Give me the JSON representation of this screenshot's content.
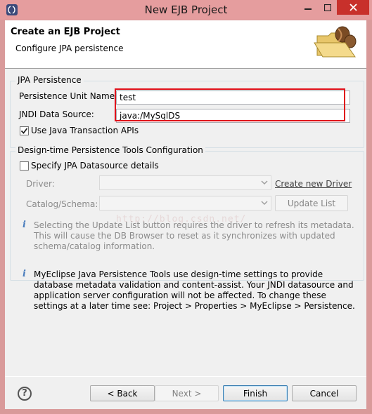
{
  "window": {
    "title": "New EJB Project",
    "icon": "eclipse-app-icon"
  },
  "banner": {
    "title": "Create an EJB Project",
    "subtitle": "Configure JPA persistence",
    "icon": "open-folder-with-beans-icon"
  },
  "jpa": {
    "group_label": "JPA Persistence",
    "unit_name_label": "Persistence Unit Name:",
    "unit_name_value": "test",
    "jndi_label": "JNDI Data Source:",
    "jndi_value": "java:/MySqlDS",
    "use_jta_label": "Use Java Transaction APIs",
    "use_jta_checked": true
  },
  "tools": {
    "group_label": "Design-time Persistence Tools Configuration",
    "specify_label": "Specify JPA Datasource details",
    "specify_checked": false,
    "driver_label": "Driver:",
    "driver_value": "",
    "create_driver_link": "Create new Driver",
    "catalog_label": "Catalog/Schema:",
    "catalog_value": "",
    "update_list_button": "Update List",
    "info_line_1": "Selecting the Update List button requires the driver to refresh its metadata.",
    "info_line_2": "This will cause the DB Browser to reset as it synchronizes with updated",
    "info_line_3": "schema/catalog information."
  },
  "note": {
    "line_1": "MyEclipse Java Persistence Tools use design-time settings to provide",
    "line_2": "database metadata validation and content-assist. Your JNDI datasource and",
    "line_3": "application server configuration will not be affected. To change these",
    "line_4": "settings at a later time see: Project > Properties > MyEclipse > Persistence."
  },
  "watermark": "http://blog.csdn.net/",
  "footer": {
    "help_symbol": "?",
    "back_label": "< Back",
    "next_label": "Next >",
    "finish_label": "Finish",
    "cancel_label": "Cancel"
  },
  "colors": {
    "titlebar": "#e59d9e",
    "close_button": "#c8302b",
    "highlight": "#e0101a"
  }
}
